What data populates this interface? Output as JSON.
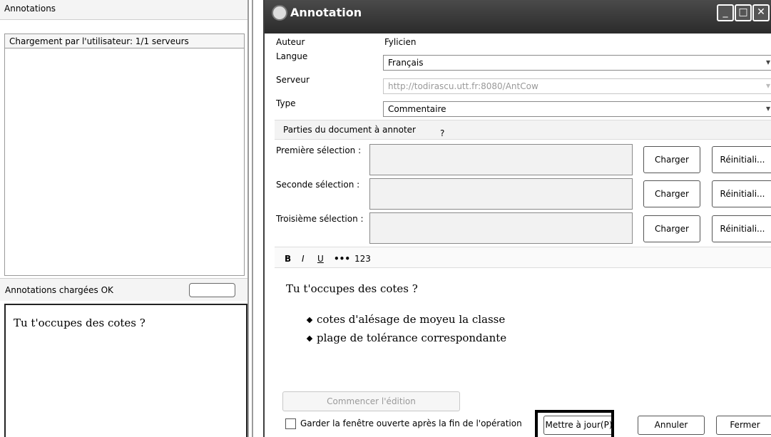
{
  "left_panel": {
    "title": "Annotations",
    "list_header": "Chargement par l'utilisateur: 1/1 serveurs",
    "status": "Annotations chargées OK",
    "editor_text": "Tu t'occupes des cotes ?"
  },
  "dialog": {
    "title": "Annotation",
    "window_buttons": {
      "minimize": "_",
      "maximize": "□",
      "close": "✕"
    },
    "author_label": "Auteur",
    "author_value": "Fylicien",
    "language_label": "Langue",
    "language_value": "Français",
    "server_label": "Serveur",
    "server_value": "http://todirascu.utt.fr:8080/AntCow",
    "type_label": "Type",
    "type_value": "Commentaire",
    "parts_label": "Parties du document à annoter",
    "parts_help": "?",
    "selections": [
      {
        "label": "Première sélection :",
        "load": "Charger",
        "reset": "Réinitiali..."
      },
      {
        "label": "Seconde sélection :",
        "load": "Charger",
        "reset": "Réinitiali..."
      },
      {
        "label": "Troisième sélection :",
        "load": "Charger",
        "reset": "Réinitiali..."
      }
    ],
    "format_toolbar": {
      "bold": "B",
      "italic": "I",
      "underline": "U",
      "bullets": "•••",
      "numbering": "123"
    },
    "editor": {
      "line1": "Tu t'occupes des cotes ?",
      "bullets": [
        "cotes d'alésage de moyeu la classe",
        "plage de tolérance correspondante"
      ]
    },
    "start_edit_button": "Commencer l'édition",
    "keep_open_label": "Garder la fenêtre ouverte après la fin de l'opération",
    "update_button": "Mettre à jour(P)",
    "cancel_button": "Annuler",
    "close_button": "Fermer",
    "arrow_glyph": "▾"
  }
}
